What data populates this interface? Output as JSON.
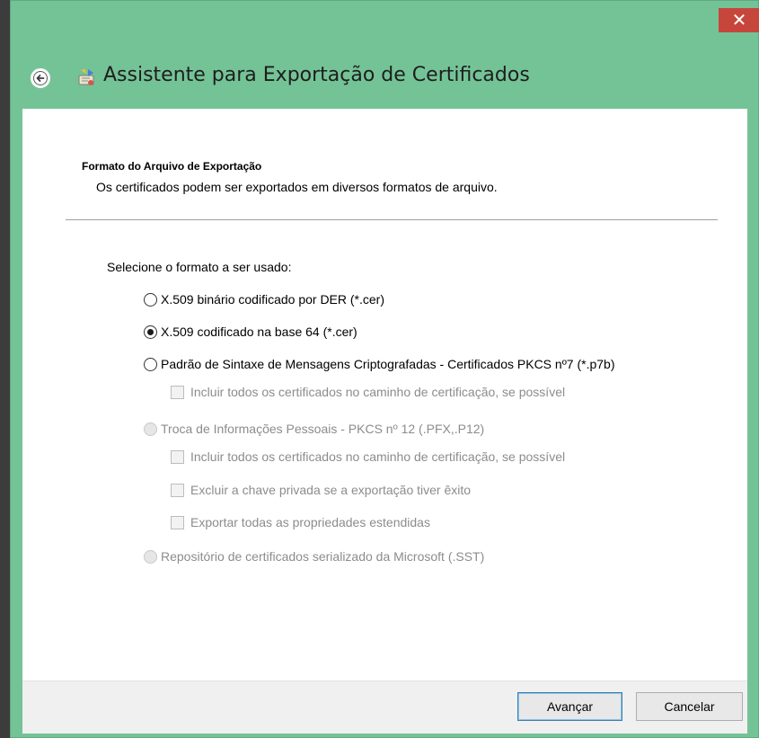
{
  "window": {
    "title": "Assistente para Exportação de Certificados",
    "close_label": "✕",
    "accent_color": "#74c397",
    "close_color": "#c7463c"
  },
  "header": {
    "section_title": "Formato do Arquivo de Exportação",
    "section_desc": "Os certificados podem ser exportados em diversos formatos de arquivo."
  },
  "main": {
    "prompt": "Selecione o formato a ser usado:",
    "options": [
      {
        "label": "X.509 binário codificado por DER (*.cer)",
        "selected": false,
        "enabled": true
      },
      {
        "label": "X.509 codificado na base 64 (*.cer)",
        "selected": true,
        "enabled": true
      },
      {
        "label": "Padrão de Sintaxe de Mensagens Criptografadas - Certificados PKCS nº7 (*.p7b)",
        "selected": false,
        "enabled": true
      },
      {
        "label": "Troca de Informações Pessoais - PKCS nº 12 (.PFX,.P12)",
        "selected": false,
        "enabled": false
      },
      {
        "label": "Repositório de certificados serializado da Microsoft (.SST)",
        "selected": false,
        "enabled": false
      }
    ],
    "p7b_include_all": "Incluir todos os certificados no caminho de certificação, se possível",
    "pfx_include_all": "Incluir todos os certificados no caminho de certificação, se possível",
    "pfx_delete_key": "Excluir a chave privada se a exportação tiver êxito",
    "pfx_export_props": "Exportar todas as propriedades estendidas"
  },
  "footer": {
    "next_label": "Avançar",
    "cancel_label": "Cancelar"
  }
}
